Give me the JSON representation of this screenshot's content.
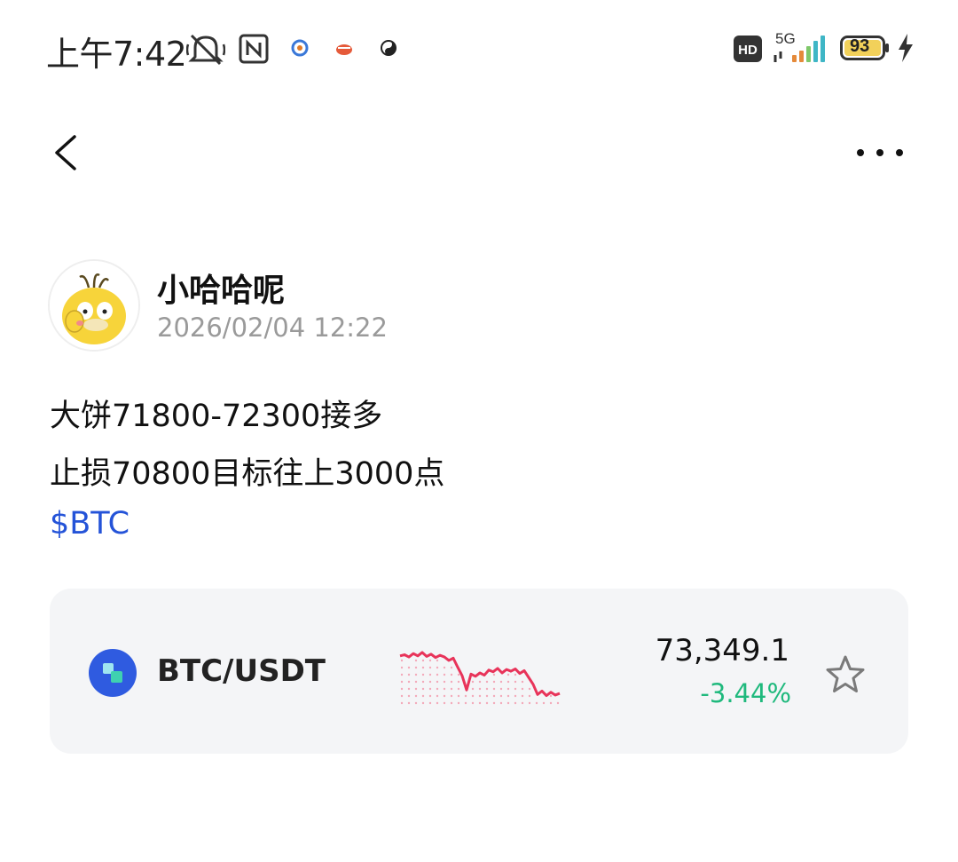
{
  "status_bar": {
    "time": "上午7:42",
    "network": "5G",
    "battery": "93",
    "icons": [
      "mute-icon",
      "nfc-icon",
      "app-notify-icon",
      "hd-icon",
      "signal-icon",
      "battery-icon",
      "charging-icon"
    ]
  },
  "nav": {
    "back_icon": "chevron-left-icon",
    "more_icon": "more-dots-icon"
  },
  "post": {
    "author": "小哈哈呢",
    "timestamp": "2026/02/04 12:22",
    "lines": [
      "大饼71800-72300接多",
      "止损70800目标往上3000点"
    ],
    "cashtag": "$BTC"
  },
  "ticker_card": {
    "pair": "BTC/USDT",
    "price": "73,349.1",
    "change": "-3.44%",
    "colors": {
      "sparkline": "#e8345a",
      "change": "#1fb97d",
      "logo": "#2f5be0",
      "cashtag": "#2453d8"
    },
    "sparkline": [
      0.8,
      0.82,
      0.78,
      0.84,
      0.8,
      0.86,
      0.79,
      0.83,
      0.77,
      0.81,
      0.78,
      0.72,
      0.76,
      0.6,
      0.45,
      0.2,
      0.48,
      0.44,
      0.5,
      0.46,
      0.55,
      0.52,
      0.58,
      0.5,
      0.56,
      0.53,
      0.57,
      0.49,
      0.54,
      0.42,
      0.3,
      0.12,
      0.18,
      0.1,
      0.16,
      0.11,
      0.14
    ]
  }
}
